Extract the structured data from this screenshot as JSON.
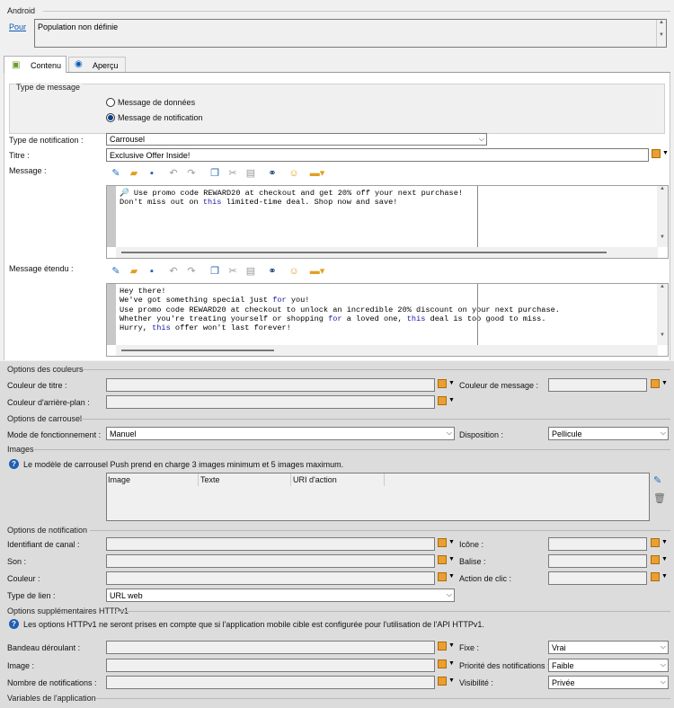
{
  "android": {
    "header": "Android",
    "pour_link": "Pour",
    "population": "Population non définie"
  },
  "tabs": [
    {
      "label": "Contenu"
    },
    {
      "label": "Aperçu"
    }
  ],
  "message_type": {
    "header": "Type de message",
    "options": [
      "Message de données",
      "Message de notification"
    ],
    "selected": 1
  },
  "notification_type": {
    "label": "Type de notification :",
    "value": "Carrousel"
  },
  "title": {
    "label": "Titre :",
    "value": "Exclusive Offer Inside!"
  },
  "message": {
    "label": "Message :",
    "lines": [
      "🔎 Use promo code REWARD20 at checkout and get 20% off your next purchase!",
      "Don't miss out on this limited-time deal. Shop now and save!"
    ]
  },
  "extended_message": {
    "label": "Message étendu :",
    "lines": [
      "Hey there!",
      "We've got something special just for you!",
      "Use promo code REWARD20 at checkout to unlock an incredible 20% discount on your next purchase.",
      "Whether you're treating yourself or shopping for a loved one, this deal is too good to miss.",
      "Hurry, this offer won't last forever!"
    ]
  },
  "colors": {
    "header": "Options des couleurs",
    "title_color": "Couleur de titre :",
    "message_color": "Couleur de message :",
    "background_color": "Couleur d'arrière-plan :"
  },
  "carousel": {
    "header": "Options de carrousel",
    "mode_label": "Mode de fonctionnement :",
    "mode_value": "Manuel",
    "layout_label": "Disposition :",
    "layout_value": "Pellicule"
  },
  "images": {
    "header": "Images",
    "info": "Le modèle de carrousel Push prend en charge 3 images minimum et 5 images maximum.",
    "columns": [
      "Image",
      "Texte",
      "URI d'action"
    ]
  },
  "notification_options": {
    "header": "Options de notification",
    "channel_label": "Identifiant de canal :",
    "icon_label": "Icône :",
    "sound_label": "Son :",
    "tag_label": "Balise :",
    "color_label": "Couleur :",
    "click_label": "Action de clic :",
    "link_type_label": "Type de lien :",
    "link_type_value": "URL web"
  },
  "httpv1": {
    "header": "Options supplémentaires HTTPv1",
    "info": "Les options HTTPv1 ne seront prises en compte que si l'application mobile cible est configurée pour l'utilisation de l'API HTTPv1.",
    "ticker_label": "Bandeau déroulant :",
    "sticky_label": "Fixe :",
    "sticky_value": "Vrai",
    "image_label": "Image :",
    "priority_label": "Priorité des notifications :",
    "priority_value": "Faible",
    "count_label": "Nombre de notifications :",
    "visibility_label": "Visibilité :",
    "visibility_value": "Privée"
  },
  "app_variables": {
    "header": "Variables de l'application"
  },
  "colors_theme": {
    "accent": "#0b57b8",
    "keyword": "#1a1aa6",
    "panel": "#f0f0f0",
    "white": "#ffffff"
  }
}
